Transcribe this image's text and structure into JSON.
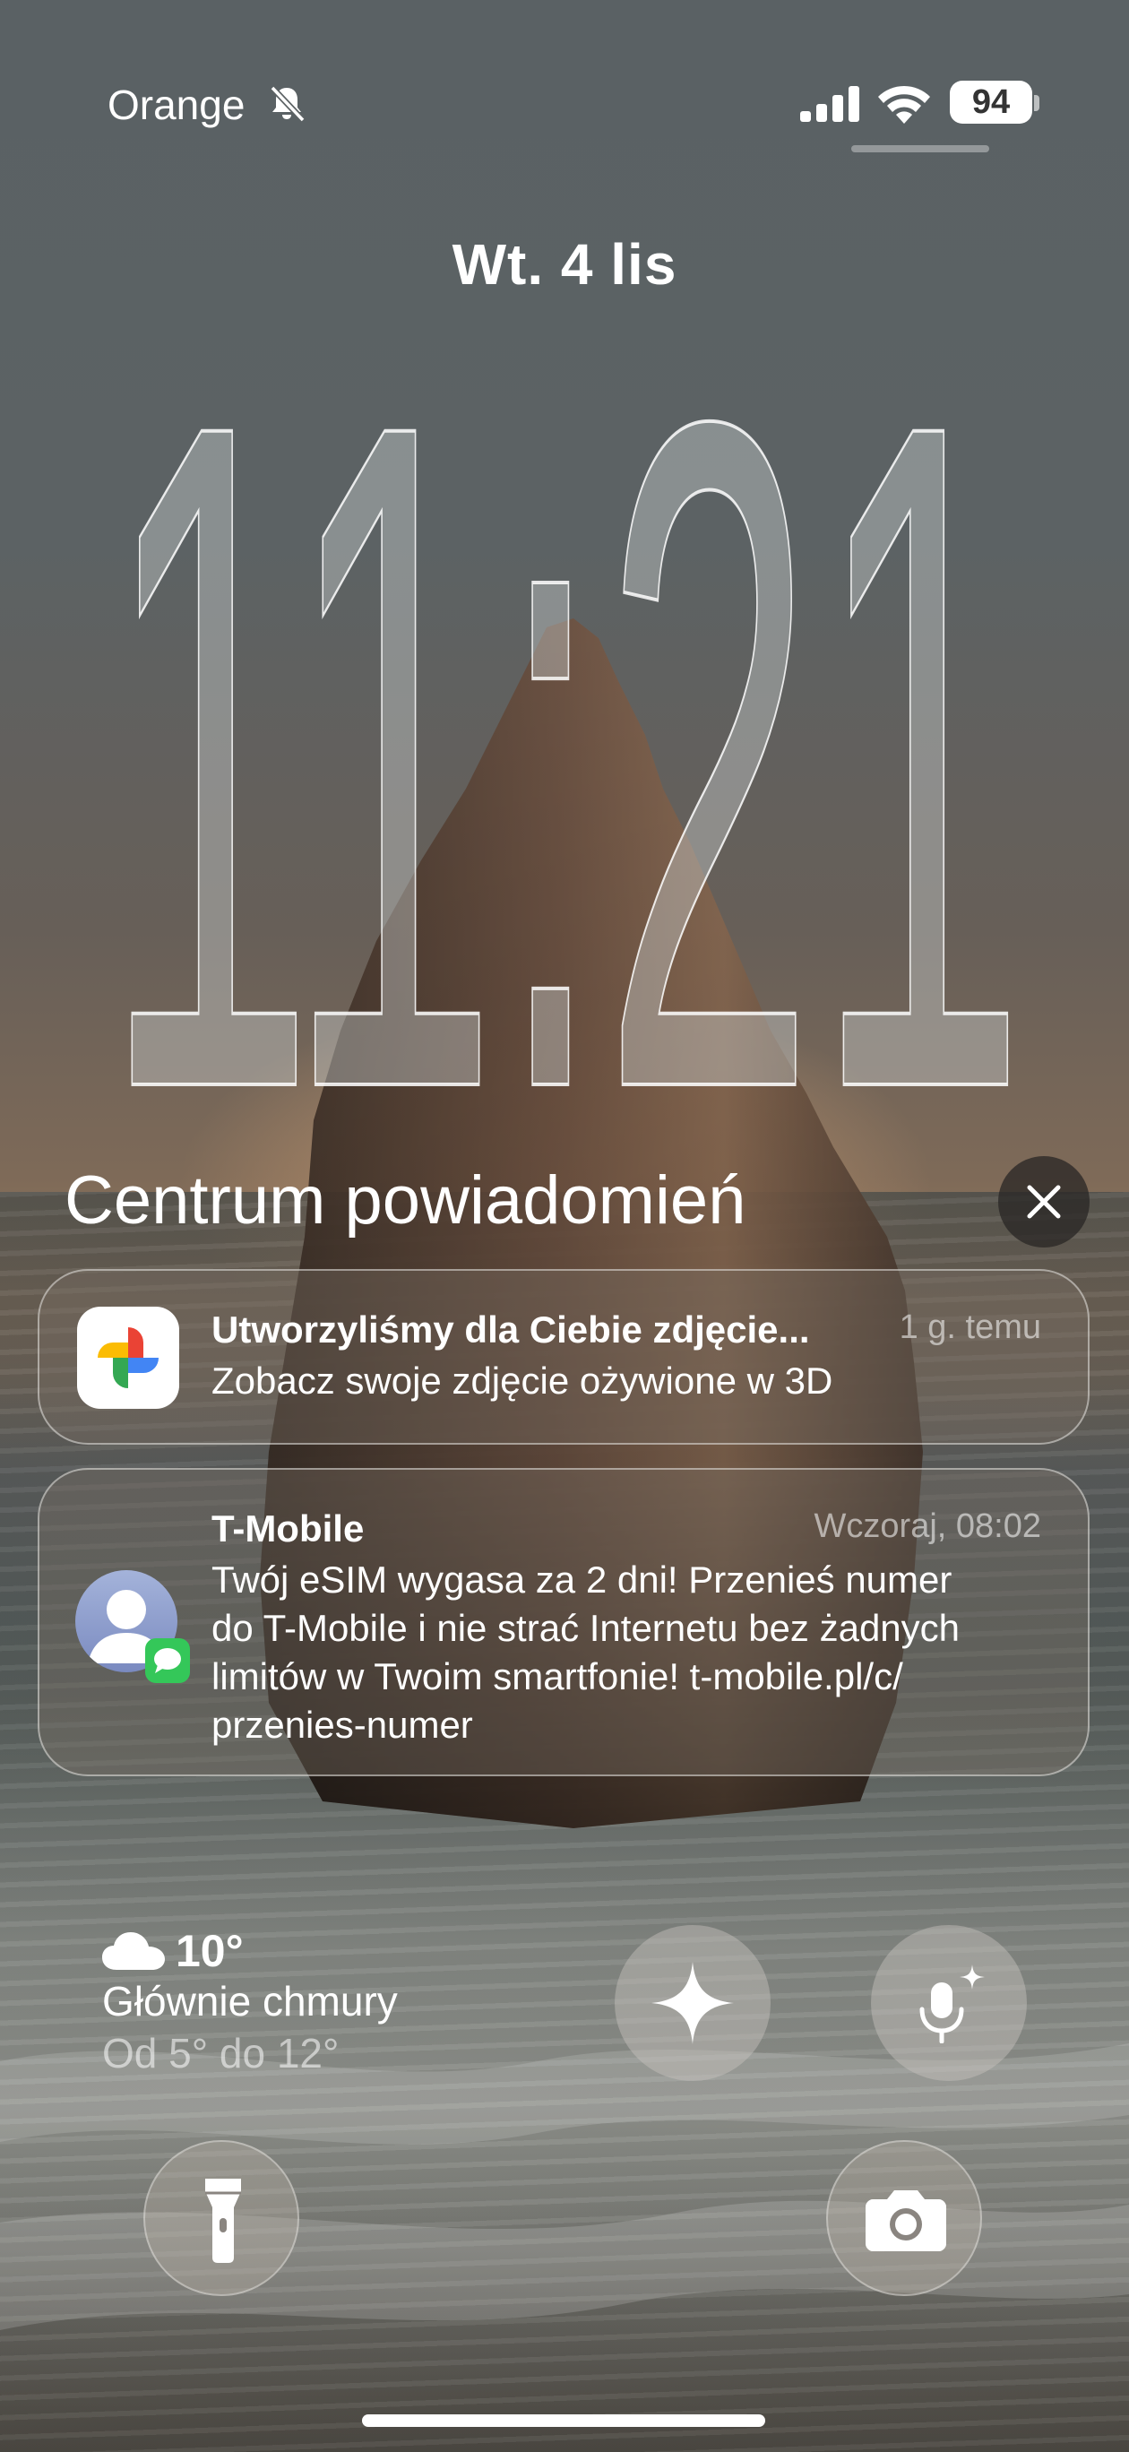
{
  "status_bar": {
    "carrier": "Orange",
    "battery": "94",
    "silent_icon": "bell-slash-icon",
    "signal_icon": "cellular-signal-icon",
    "wifi_icon": "wifi-icon"
  },
  "lock": {
    "date": "Wt. 4 lis",
    "time": "11:21"
  },
  "notification_center": {
    "title": "Centrum powiadomień",
    "close_icon": "close-icon",
    "notifications": [
      {
        "app_icon": "google-photos-icon",
        "title": "Utworzyliśmy dla Ciebie zdjęcie...",
        "time": "1 g. temu",
        "body": "Zobacz swoje zdjęcie ożywione w 3D"
      },
      {
        "app_icon": "contact-avatar-icon",
        "badge_icon": "messages-icon",
        "title": "T-Mobile",
        "time": "Wczoraj, 08:02",
        "body_lines": [
          "Twój eSIM wygasa za 2 dni! Przenieś numer",
          "do T-Mobile i nie strać Internetu bez żadnych",
          "limitów w Twoim smartfonie! t-mobile.pl/c/",
          "przenies-numer"
        ]
      }
    ]
  },
  "weather": {
    "icon": "cloud-icon",
    "temperature": "10°",
    "condition": "Głównie chmury",
    "range": "Od 5° do 12°"
  },
  "controls": {
    "ai_icon": "sparkle-icon",
    "voice_icon": "microphone-sparkle-icon",
    "flashlight_icon": "flashlight-icon",
    "camera_icon": "camera-icon"
  },
  "colors": {
    "text": "#ffffff",
    "battery_fill": "#ffffff",
    "messages_badge": "#34c759"
  }
}
